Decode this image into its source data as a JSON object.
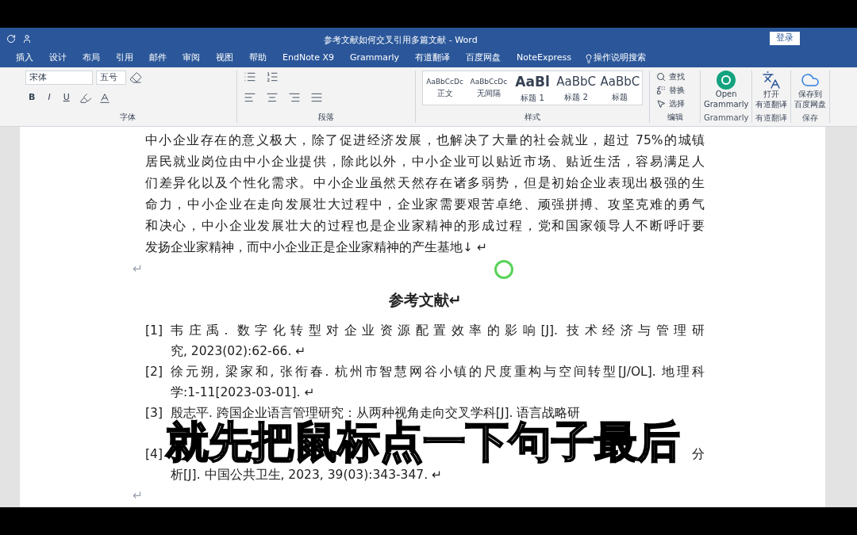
{
  "window": {
    "title": "参考文献如何交叉引用多篇文献 - Word",
    "login": "登录"
  },
  "tabs": [
    {
      "label": "插入",
      "selected": false
    },
    {
      "label": "设计",
      "selected": false
    },
    {
      "label": "布局",
      "selected": false
    },
    {
      "label": "引用",
      "selected": false
    },
    {
      "label": "邮件",
      "selected": false
    },
    {
      "label": "审阅",
      "selected": false
    },
    {
      "label": "视图",
      "selected": false
    },
    {
      "label": "帮助",
      "selected": false
    },
    {
      "label": "EndNote X9",
      "selected": false
    },
    {
      "label": "Grammarly",
      "selected": false
    },
    {
      "label": "有道翻译",
      "selected": false
    },
    {
      "label": "百度网盘",
      "selected": false
    },
    {
      "label": "NoteExpress",
      "selected": false
    }
  ],
  "tell_me": "操作说明搜索",
  "ribbon": {
    "font": {
      "name": "宋体",
      "size": "五号",
      "format_buttons": [
        "B",
        "I",
        "U"
      ],
      "label": "字体"
    },
    "paragraph": {
      "label": "段落"
    },
    "styles": {
      "label": "样式",
      "items": [
        {
          "sample": "AaBbCcDc",
          "name": "正文",
          "kind": "small"
        },
        {
          "sample": "AaBbCcDc",
          "name": "无间隔",
          "kind": "small"
        },
        {
          "sample": "AaBl",
          "name": "标题 1",
          "kind": "bold"
        },
        {
          "sample": "AaBbC",
          "name": "标题 2",
          "kind": "large"
        },
        {
          "sample": "AaBbC",
          "name": "标题",
          "kind": "large"
        }
      ]
    },
    "editing": {
      "label": "编辑",
      "items": [
        "查找",
        "替换",
        "选择"
      ]
    },
    "addins": [
      {
        "lines": [
          "Open",
          "Grammarly"
        ],
        "group": "Grammarly",
        "kind": "grammarly"
      },
      {
        "lines": [
          "打开",
          "有道翻译"
        ],
        "group": "有道翻译",
        "kind": "translate"
      },
      {
        "lines": [
          "保存到",
          "百度网盘"
        ],
        "group": "保存",
        "kind": "cloud"
      }
    ]
  },
  "document": {
    "paragraph": [
      "中小企业存在的意义极大，除了促进经济发展，也解决了大量的社会就业，超过 75%的城镇",
      "居民就业岗位由中小企业提供，除此以外，中小企业可以贴近市场、贴近生活，容易满足人",
      "们差异化以及个性化需求。中小企业虽然天然存在诸多弱势，但是初始企业表现出极强的生",
      "命力，中小企业在走向发展壮大过程中，企业家需要艰苦卓绝、顽强拼搏、攻坚克难的勇气",
      "和决心，中小企业发展壮大的过程也是企业家精神的形成过程，党和国家领导人不断呼吁要",
      "发扬企业家精神，而中小企业正是企业家精神的产生基地↓ ↵"
    ],
    "empty_mark": "↵",
    "heading": "参考文献↵",
    "references": [
      {
        "number": "[1]",
        "lines": [
          "韦庄禹. 数字化转型对企业资源配置效率的影响[J]. 技术经济与管理研",
          "究, 2023(02):62-66. ↵"
        ]
      },
      {
        "number": "[2]",
        "lines": [
          "徐元朔, 梁家和, 张衔春. 杭州市智慧网谷小镇的尺度重构与空间转型[J/OL]. 地理科",
          "学:1-11[2023-03-01]. ↵"
        ]
      },
      {
        "number": "[3]",
        "kind": "covered_below",
        "lines": [
          "殷志平. 跨国企业语言管理研究：从两种视角走向交叉学科[J]. 语言战略研"
        ]
      },
      {
        "number": "[4]",
        "kind": "covered_start",
        "lines": [
          "分",
          "析[J]. 中国公共卫生, 2023, 39(03):343-347. ↵"
        ]
      }
    ],
    "end_mark": "↵"
  },
  "subtitle": "就先把鼠标点一下句子最后"
}
